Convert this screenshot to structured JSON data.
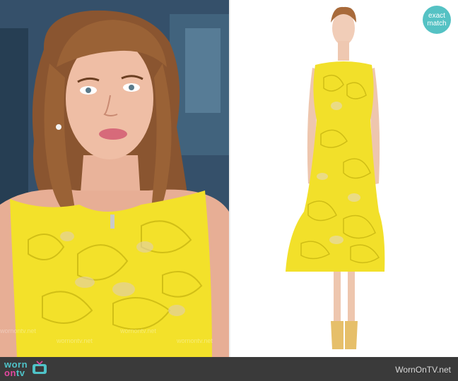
{
  "badge": {
    "line1": "exact",
    "line2": "match"
  },
  "footer": {
    "logo_word1": "worn",
    "logo_word2": "on",
    "logo_word3": "tv",
    "site": "WornOnTV.net"
  },
  "watermark": {
    "text": "wornontv.net"
  },
  "colors": {
    "accent": "#55c2c4",
    "dress": "#f3e12a",
    "footer_bg": "#3a3a3a"
  }
}
